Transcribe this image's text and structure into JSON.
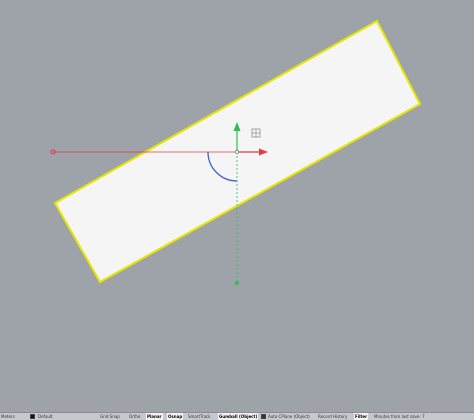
{
  "colors": {
    "viewport_bg": "#9ea3aa",
    "surface_fill": "#f5f5f5",
    "selection_outline": "#e6e600",
    "gumball_x": "#e03c3c",
    "gumball_y": "#2fbf4f",
    "gumball_rotate": "#3b63c9"
  },
  "icons": {
    "gumball_scale_handle": "plane-handle-icon",
    "x_arrow": "arrow-right-icon",
    "y_arrow": "arrow-up-icon"
  },
  "statusbar": {
    "units": "Meters",
    "layer": "Default",
    "grid_snap": "Grid Snap",
    "ortho": "Ortho",
    "planar": "Planar",
    "osnap": "Osnap",
    "smarttrack": "SmartTrack",
    "gumball": "Gumball (Object)",
    "auto_cplane": "Auto CPlane (Object)",
    "record_history": "Record History",
    "filter": "Filter",
    "save_status": "Minutes from last save: 7"
  }
}
